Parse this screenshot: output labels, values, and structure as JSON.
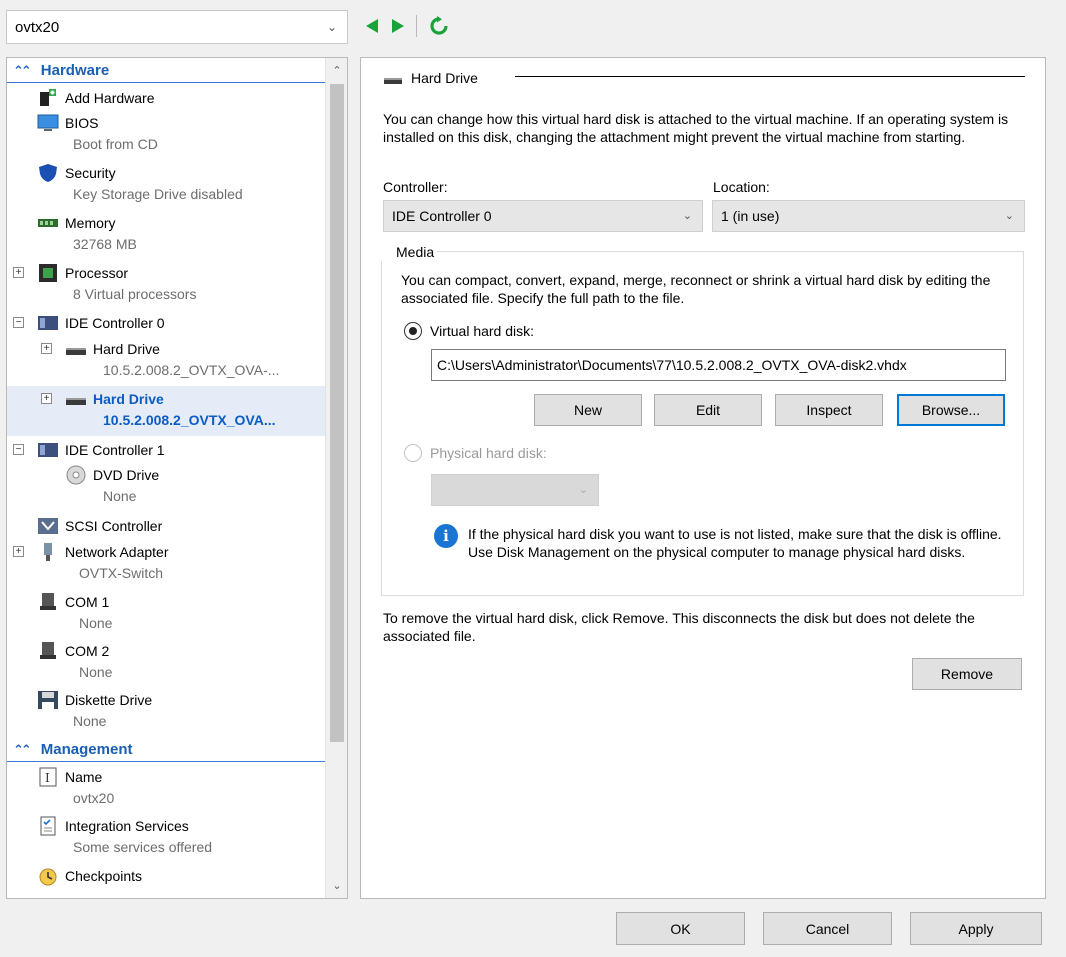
{
  "vm_selector": {
    "value": "ovtx20"
  },
  "tree": {
    "sections": [
      {
        "label": "Hardware"
      },
      {
        "label": "Management"
      }
    ],
    "items": [
      {
        "label": "Add Hardware",
        "sub": ""
      },
      {
        "label": "BIOS",
        "sub": "Boot from CD"
      },
      {
        "label": "Security",
        "sub": "Key Storage Drive disabled"
      },
      {
        "label": "Memory",
        "sub": "32768 MB"
      },
      {
        "label": "Processor",
        "sub": "8 Virtual processors"
      },
      {
        "label": "IDE Controller 0",
        "sub": ""
      },
      {
        "label": "Hard Drive",
        "sub": "10.5.2.008.2_OVTX_OVA-..."
      },
      {
        "label": "Hard Drive",
        "sub": "10.5.2.008.2_OVTX_OVA..."
      },
      {
        "label": "IDE Controller 1",
        "sub": ""
      },
      {
        "label": "DVD Drive",
        "sub": "None"
      },
      {
        "label": "SCSI Controller",
        "sub": ""
      },
      {
        "label": "Network Adapter",
        "sub": "OVTX-Switch"
      },
      {
        "label": "COM 1",
        "sub": "None"
      },
      {
        "label": "COM 2",
        "sub": "None"
      },
      {
        "label": "Diskette Drive",
        "sub": "None"
      },
      {
        "label": "Name",
        "sub": "ovtx20"
      },
      {
        "label": "Integration Services",
        "sub": "Some services offered"
      },
      {
        "label": "Checkpoints",
        "sub": ""
      }
    ]
  },
  "panel": {
    "title": "Hard Drive",
    "description": "You can change how this virtual hard disk is attached to the virtual machine. If an operating system is installed on this disk, changing the attachment might prevent the virtual machine from starting.",
    "controller_label": "Controller:",
    "controller_value": "IDE Controller 0",
    "location_label": "Location:",
    "location_value": "1 (in use)",
    "media_label": "Media",
    "media_description": "You can compact, convert, expand, merge, reconnect or shrink a virtual hard disk by editing the associated file. Specify the full path to the file.",
    "vhd_label": "Virtual hard disk:",
    "vhd_path": "C:\\Users\\Administrator\\Documents\\77\\10.5.2.008.2_OVTX_OVA-disk2.vhdx",
    "buttons": {
      "new": "New",
      "edit": "Edit",
      "inspect": "Inspect",
      "browse": "Browse..."
    },
    "physical_label": "Physical hard disk:",
    "info_text": "If the physical hard disk you want to use is not listed, make sure that the disk is offline. Use Disk Management on the physical computer to manage physical hard disks.",
    "remove_text": "To remove the virtual hard disk, click Remove. This disconnects the disk but does not delete the associated file.",
    "remove_button": "Remove"
  },
  "footer": {
    "ok": "OK",
    "cancel": "Cancel",
    "apply": "Apply"
  },
  "colors": {
    "accent": "#0078d7",
    "nav_green": "#1aa33a",
    "selected_text": "#0a5bc4"
  }
}
